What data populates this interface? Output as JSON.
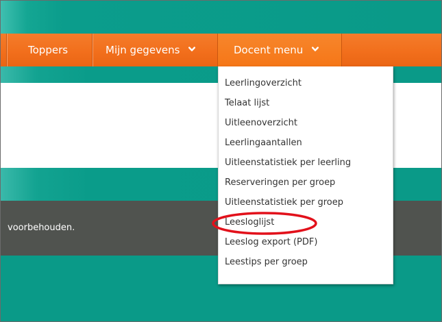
{
  "nav": {
    "items": [
      {
        "label": "Toppers",
        "has_dropdown": false
      },
      {
        "label": "Mijn gegevens",
        "has_dropdown": true
      },
      {
        "label": "Docent menu",
        "has_dropdown": true,
        "active": true
      }
    ]
  },
  "dropdown": {
    "items": [
      {
        "label": "Leerlingoverzicht"
      },
      {
        "label": "Telaat lijst"
      },
      {
        "label": "Uitleenoverzicht"
      },
      {
        "label": "Leerlingaantallen"
      },
      {
        "label": "Uitleenstatistiek per leerling"
      },
      {
        "label": "Reserveringen per groep"
      },
      {
        "label": "Uitleenstatistiek per groep"
      },
      {
        "label": "Leesloglijst",
        "highlighted": true
      },
      {
        "label": "Leeslog export (PDF)"
      },
      {
        "label": "Leestips per groep"
      }
    ]
  },
  "footer": {
    "text": "voorbehouden."
  },
  "colors": {
    "teal": "#0a9a88",
    "orange": "#f26f1c",
    "footer": "#50534f",
    "highlight": "#e2111b"
  },
  "icons": {
    "dropdown_chevron": "chevron-down-icon"
  }
}
